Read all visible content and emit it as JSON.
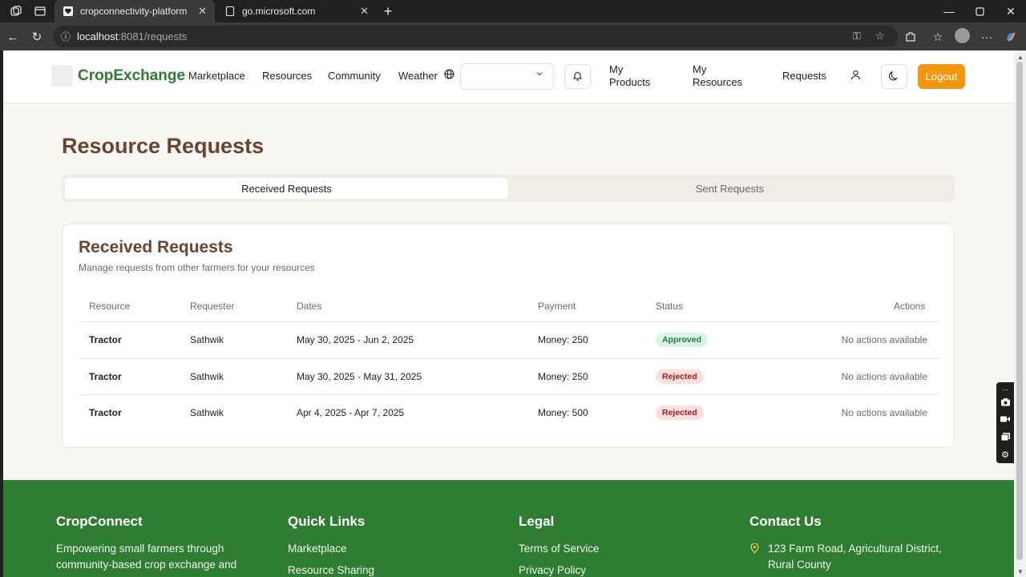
{
  "browser": {
    "tabs": [
      {
        "title": "cropconnectivity-platform",
        "active": true
      },
      {
        "title": "go.microsoft.com",
        "active": false
      }
    ],
    "url_host": "localhost",
    "url_path": ":8081/requests",
    "icons": {
      "tab_actions": "tab-actions-icon",
      "tab_list": "tab-list-icon",
      "new_tab": "+",
      "back": "←",
      "refresh": "↻",
      "close": "✕",
      "minimize": "—",
      "maximize": "▢"
    }
  },
  "header": {
    "brand": "CropExchange",
    "nav": [
      "Marketplace",
      "Resources",
      "Community",
      "Weather"
    ],
    "language_value": "",
    "my_products": "My Products",
    "my_resources": "My Resources",
    "requests": "Requests",
    "logout": "Logout"
  },
  "page": {
    "title": "Resource Requests",
    "tabs": [
      "Received Requests",
      "Sent Requests"
    ],
    "active_tab": "Received Requests"
  },
  "card": {
    "title": "Received Requests",
    "subtitle": "Manage requests from other farmers for your resources",
    "columns": [
      "Resource",
      "Requester",
      "Dates",
      "Payment",
      "Status",
      "Actions"
    ],
    "rows": [
      {
        "resource": "Tractor",
        "requester": "Sathwik",
        "dates": "May 30, 2025 - Jun 2, 2025",
        "payment": "Money: 250",
        "status": "Approved",
        "actions": "No actions available"
      },
      {
        "resource": "Tractor",
        "requester": "Sathwik",
        "dates": "May 30, 2025 - May 31, 2025",
        "payment": "Money: 250",
        "status": "Rejected",
        "actions": "No actions available"
      },
      {
        "resource": "Tractor",
        "requester": "Sathwik",
        "dates": "Apr 4, 2025 - Apr 7, 2025",
        "payment": "Money: 500",
        "status": "Rejected",
        "actions": "No actions available"
      }
    ]
  },
  "footer": {
    "about_title": "CropConnect",
    "about_text": "Empowering small farmers through community-based crop exchange and",
    "links_title": "Quick Links",
    "links": [
      "Marketplace",
      "Resource Sharing"
    ],
    "legal_title": "Legal",
    "legal_links": [
      "Terms of Service",
      "Privacy Policy"
    ],
    "contact_title": "Contact Us",
    "address_line1": "123 Farm Road, Agricultural District,",
    "address_line2": "Rural County"
  },
  "colors": {
    "brand_green": "#2e7d32",
    "title_brown": "#6a4430",
    "logout_orange": "#f5960f",
    "approved_bg": "#dcf5e2",
    "rejected_bg": "#fbdede"
  }
}
